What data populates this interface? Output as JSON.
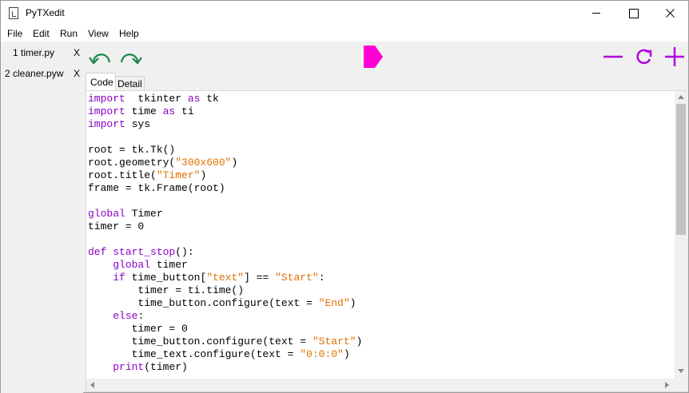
{
  "window": {
    "title": "PyTXedit",
    "icon": "python-file-icon"
  },
  "menu": [
    "File",
    "Edit",
    "Run",
    "View",
    "Help"
  ],
  "file_tabs": [
    {
      "label": "1 timer.py",
      "close": "X"
    },
    {
      "label": "2 cleaner.pyw",
      "close": "X"
    }
  ],
  "toolbar": {
    "undo_icon": "undo-arrow-icon",
    "redo_icon": "redo-arrow-icon",
    "run_icon": "run-tag-icon",
    "zoom_out_icon": "minus-icon",
    "reset_zoom_icon": "refresh-icon",
    "zoom_in_icon": "plus-icon",
    "colors": {
      "arrows": "#1a8a4a",
      "accent": "#ff00d4",
      "zoom": "#b000e0"
    }
  },
  "editor_tabs": [
    "Code",
    "Detail"
  ],
  "code_lines": [
    [
      [
        "kw",
        "import"
      ],
      [
        "",
        "  tkinter "
      ],
      [
        "kw",
        "as"
      ],
      [
        "",
        " tk"
      ]
    ],
    [
      [
        "kw",
        "import"
      ],
      [
        "",
        " time "
      ],
      [
        "kw",
        "as"
      ],
      [
        "",
        " ti"
      ]
    ],
    [
      [
        "kw",
        "import"
      ],
      [
        "",
        " sys"
      ]
    ],
    [],
    [
      [
        "",
        "root = tk.Tk()"
      ]
    ],
    [
      [
        "",
        "root.geometry("
      ],
      [
        "str",
        "\"300x600\""
      ],
      [
        "",
        ")"
      ]
    ],
    [
      [
        "",
        "root.title("
      ],
      [
        "str",
        "\"Timer\""
      ],
      [
        "",
        ")"
      ]
    ],
    [
      [
        "",
        "frame = tk.Frame(root)"
      ]
    ],
    [],
    [
      [
        "kw",
        "global"
      ],
      [
        "",
        " Timer"
      ]
    ],
    [
      [
        "",
        "timer = 0"
      ]
    ],
    [],
    [
      [
        "kw",
        "def"
      ],
      [
        "",
        " "
      ],
      [
        "fn",
        "start_stop"
      ],
      [
        "",
        "():"
      ]
    ],
    [
      [
        "",
        "    "
      ],
      [
        "kw",
        "global"
      ],
      [
        "",
        " timer"
      ]
    ],
    [
      [
        "",
        "    "
      ],
      [
        "kw",
        "if"
      ],
      [
        "",
        " time_button["
      ],
      [
        "str",
        "\"text\""
      ],
      [
        "",
        "] == "
      ],
      [
        "str",
        "\"Start\""
      ],
      [
        "",
        ":"
      ]
    ],
    [
      [
        "",
        "        timer = ti.time()"
      ]
    ],
    [
      [
        "",
        "        time_button.configure(text = "
      ],
      [
        "str",
        "\"End\""
      ],
      [
        "",
        ")"
      ]
    ],
    [
      [
        "",
        "    "
      ],
      [
        "kw",
        "else"
      ],
      [
        "",
        ":"
      ]
    ],
    [
      [
        "",
        "       timer = 0"
      ]
    ],
    [
      [
        "",
        "       time_button.configure(text = "
      ],
      [
        "str",
        "\"Start\""
      ],
      [
        "",
        ")"
      ]
    ],
    [
      [
        "",
        "       time_text.configure(text = "
      ],
      [
        "str",
        "\"0:0:0\""
      ],
      [
        "",
        ")"
      ]
    ],
    [
      [
        "",
        "    "
      ],
      [
        "kw",
        "print"
      ],
      [
        "",
        "(timer)"
      ]
    ]
  ]
}
